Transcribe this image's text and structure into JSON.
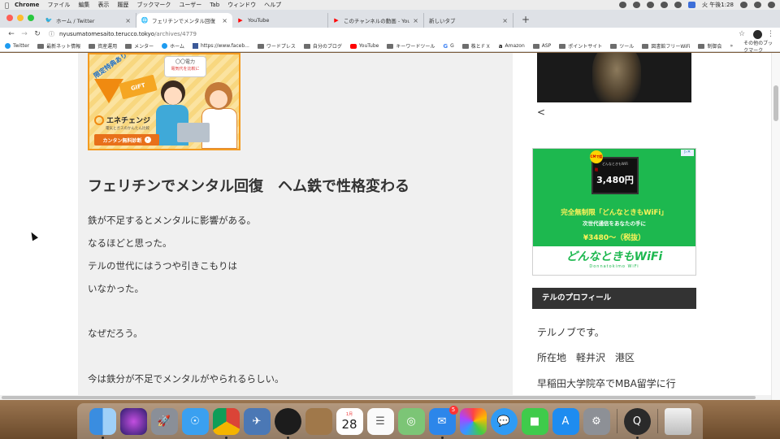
{
  "menubar": {
    "app": "Chrome",
    "items": [
      "ファイル",
      "編集",
      "表示",
      "履歴",
      "ブックマーク",
      "ユーザー",
      "Tab",
      "ウィンドウ",
      "ヘルプ"
    ],
    "clock": "火 午後1:28"
  },
  "tabs": [
    {
      "title": "ホーム / Twitter",
      "icon": "twitter-icon",
      "color": "#1d9bf0"
    },
    {
      "title": "フェリチンでメンタル回復　ヘム鉄",
      "icon": "globe-icon",
      "active": true
    },
    {
      "title": "YouTube",
      "icon": "youtube-icon",
      "color": "#ff0000"
    },
    {
      "title": "このチャンネルの動画 - YouTube",
      "icon": "youtube-icon",
      "color": "#ff0000"
    },
    {
      "title": "新しいタブ",
      "icon": "blank-icon"
    }
  ],
  "address": {
    "domain": "nyusumatomesaito.terucco.tokyo",
    "path": "/archives/4779"
  },
  "bookmarks": [
    {
      "label": "Twitter",
      "icon": "twitter"
    },
    {
      "label": "最新ネット情報",
      "icon": "folder"
    },
    {
      "label": "資産運用",
      "icon": "folder"
    },
    {
      "label": "メンター",
      "icon": "folder"
    },
    {
      "label": "ホーム",
      "icon": "twitter"
    },
    {
      "label": "https://www.faceb...",
      "icon": "facebook"
    },
    {
      "label": "ワードプレス",
      "icon": "folder"
    },
    {
      "label": "自分のブログ",
      "icon": "folder"
    },
    {
      "label": "YouTube",
      "icon": "youtube"
    },
    {
      "label": "キーワードツール",
      "icon": "folder"
    },
    {
      "label": "G",
      "icon": "google"
    },
    {
      "label": "株とＦＸ",
      "icon": "folder"
    },
    {
      "label": "Amazon",
      "icon": "amazon"
    },
    {
      "label": "ASP",
      "icon": "folder"
    },
    {
      "label": "ポイントサイト",
      "icon": "folder"
    },
    {
      "label": "ツール",
      "icon": "folder"
    },
    {
      "label": "図書館フリーWiFi",
      "icon": "folder"
    },
    {
      "label": "制御会",
      "icon": "folder"
    }
  ],
  "bookmarks_overflow": "»",
  "bookmarks_other": "その他のブックマーク",
  "banner": {
    "bubble_line1": "〇〇電力",
    "bubble_line2": "電気代を比較に",
    "gentei": "限定特典あり",
    "gift": "GIFT",
    "brand": "エネチェンジ",
    "sub": "電気とガスのかんたん比較",
    "cta": "カンタン無料診断"
  },
  "article": {
    "title": "フェリチンでメンタル回復　ヘム鉄で性格変わる",
    "paragraphs": [
      "鉄が不足するとメンタルに影響がある。",
      "なるほどと思った。",
      "テルの世代にはうつや引きこもりは",
      "いなかった。",
      "なぜだろう。",
      "今は鉄分が不足でメンタルがやられるらしい。"
    ]
  },
  "sidebar": {
    "prev": "<",
    "ad": {
      "badge": "CMで話題",
      "device_tiny": "どんなときもWiFi",
      "price": "3,480円",
      "line1": "完全無制限「どんなときもWiFi」",
      "line2": "次世代通信をあなたの手に",
      "line3": "¥3480～（税抜）",
      "logo": "どんなときもWiFi",
      "logo_sub": "Donnatokimo WiFi",
      "adchoice": "▷✕"
    },
    "profile_title": "テルのプロフィール",
    "profile_lines": [
      "テルノブです。",
      "所在地　軽井沢　港区",
      "早稲田大学院卒でMBA留学に行"
    ]
  },
  "dock": {
    "calendar_month": "1月",
    "calendar_day": "28",
    "mail_badge": "5"
  }
}
